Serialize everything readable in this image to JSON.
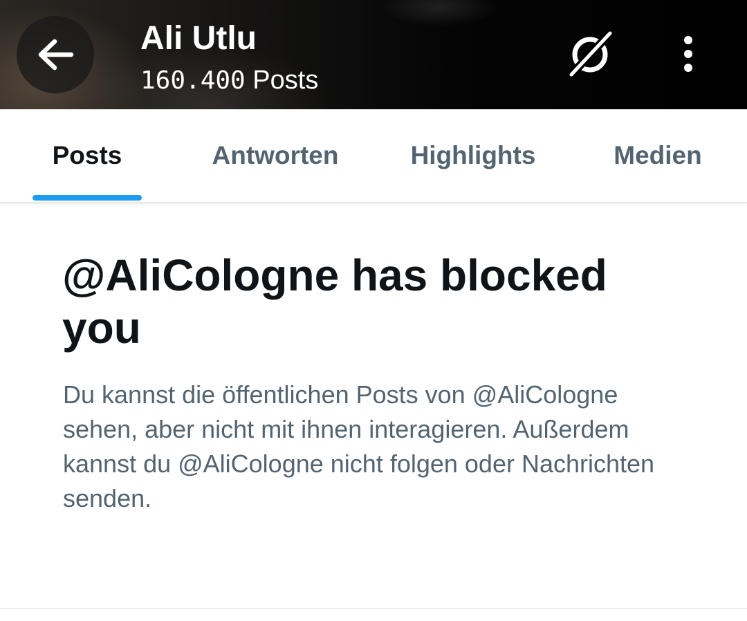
{
  "header": {
    "back_icon": "arrow-left-icon",
    "title": "Ali Utlu",
    "post_count": "160.400",
    "post_count_label": "Posts",
    "grok_icon": "grok-icon",
    "more_icon": "more-vertical-icon"
  },
  "tabs": [
    {
      "label": "Posts",
      "active": true
    },
    {
      "label": "Antworten",
      "active": false
    },
    {
      "label": "Highlights",
      "active": false
    },
    {
      "label": "Medien",
      "active": false
    }
  ],
  "blocked": {
    "heading_line1": "@AliCologne has blocked",
    "heading_line2": "you",
    "description": "Du kannst die öffentlichen Posts von @AliCologne sehen, aber nicht mit ihnen interagieren. Außerdem kannst du @AliCologne nicht folgen oder Nachrichten senden."
  },
  "colors": {
    "accent": "#1d9bf0",
    "text_primary": "#0f1419",
    "text_secondary": "#536471"
  }
}
